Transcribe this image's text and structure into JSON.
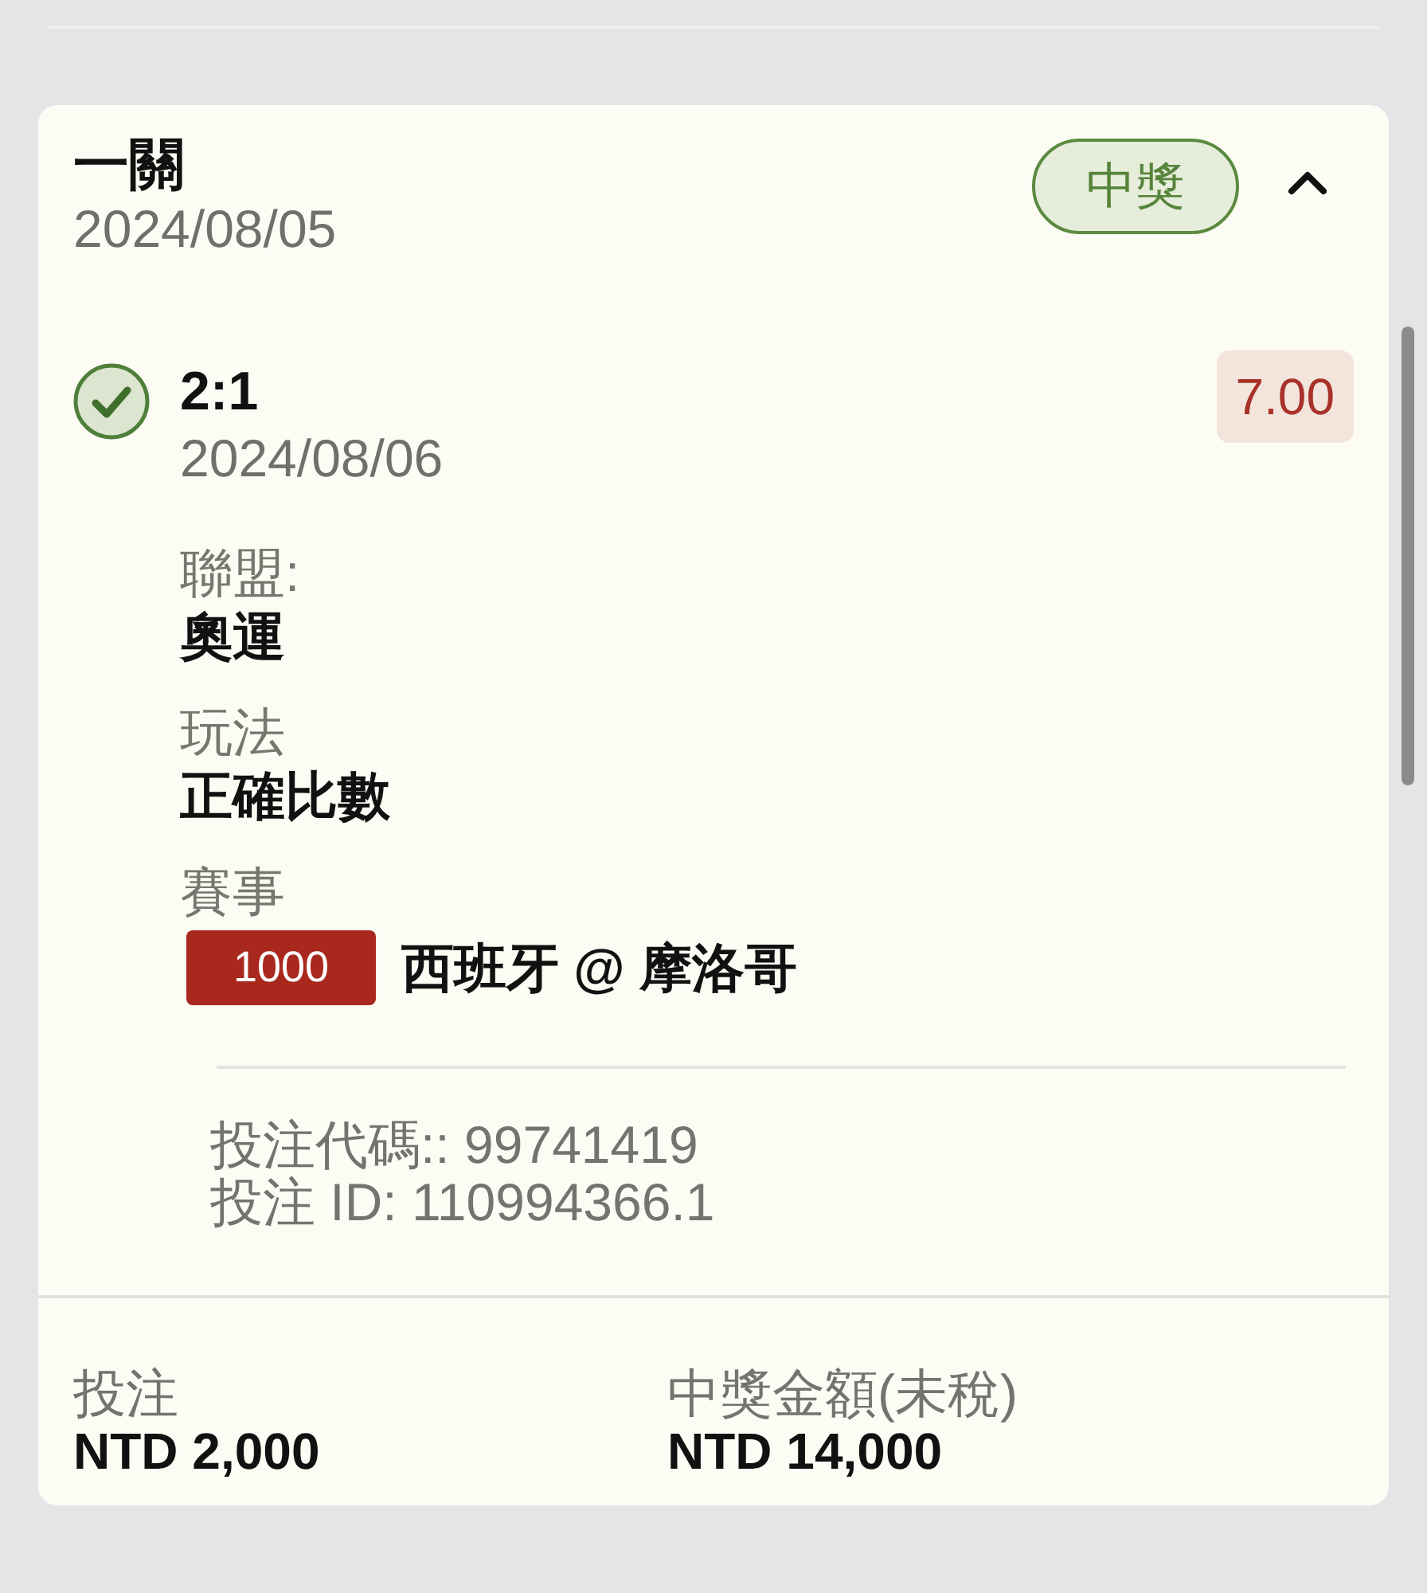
{
  "card": {
    "title": "一關",
    "date": "2024/08/05",
    "status_badge": "中獎",
    "expanded": true
  },
  "selections": [
    {
      "checked": true,
      "pick": "2:1",
      "date": "2024/08/06",
      "odds": "7.00",
      "fields": [
        {
          "kind": "text",
          "label": "聯盟:",
          "value": "奧運"
        },
        {
          "kind": "text",
          "label": "玩法",
          "value": "正確比數"
        },
        {
          "kind": "match",
          "label": "賽事",
          "match_code": "1000",
          "value": "西班牙 @ 摩洛哥"
        }
      ]
    }
  ],
  "bet_info": [
    "投注代碼:: 99741419",
    "投注 ID: 110994366.1"
  ],
  "summary": [
    {
      "label": "投注",
      "value": "NTD 2,000"
    },
    {
      "label": "中獎金額(未稅)",
      "value": "NTD 14,000"
    }
  ]
}
